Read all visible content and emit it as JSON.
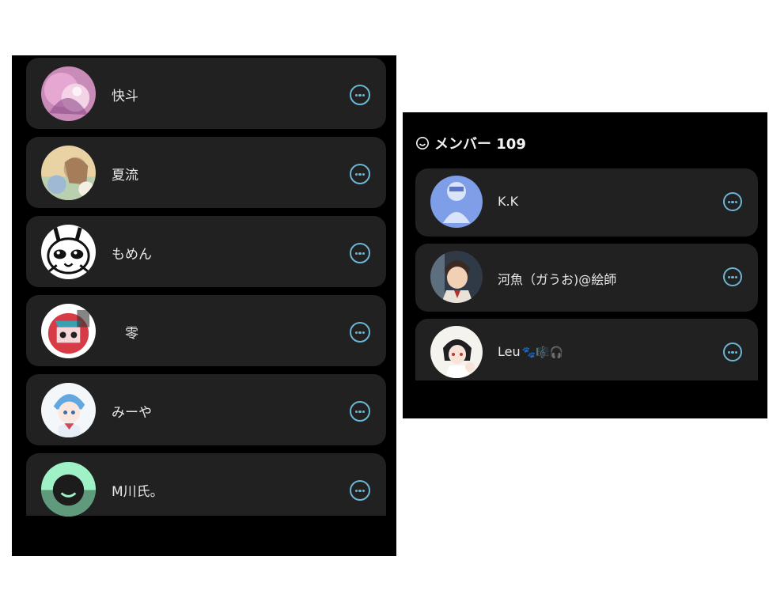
{
  "left_panel": {
    "members": [
      {
        "name": "快斗"
      },
      {
        "name": "夏流"
      },
      {
        "name": "もめん"
      },
      {
        "name": "　零"
      },
      {
        "name": "みーや"
      },
      {
        "name": "M川氏。"
      }
    ]
  },
  "right_panel": {
    "header": {
      "title": "メンバー 109",
      "icon": "smile-icon"
    },
    "members": [
      {
        "name": "K.K"
      },
      {
        "name": "河魚（ガうお)@絵師"
      },
      {
        "name": "Leu",
        "emoji": "🐾🎼🎧"
      }
    ]
  },
  "colors": {
    "background": "#000000",
    "card": "#212121",
    "text": "#e8e8e8",
    "more_icon": "#6bb6d6"
  }
}
